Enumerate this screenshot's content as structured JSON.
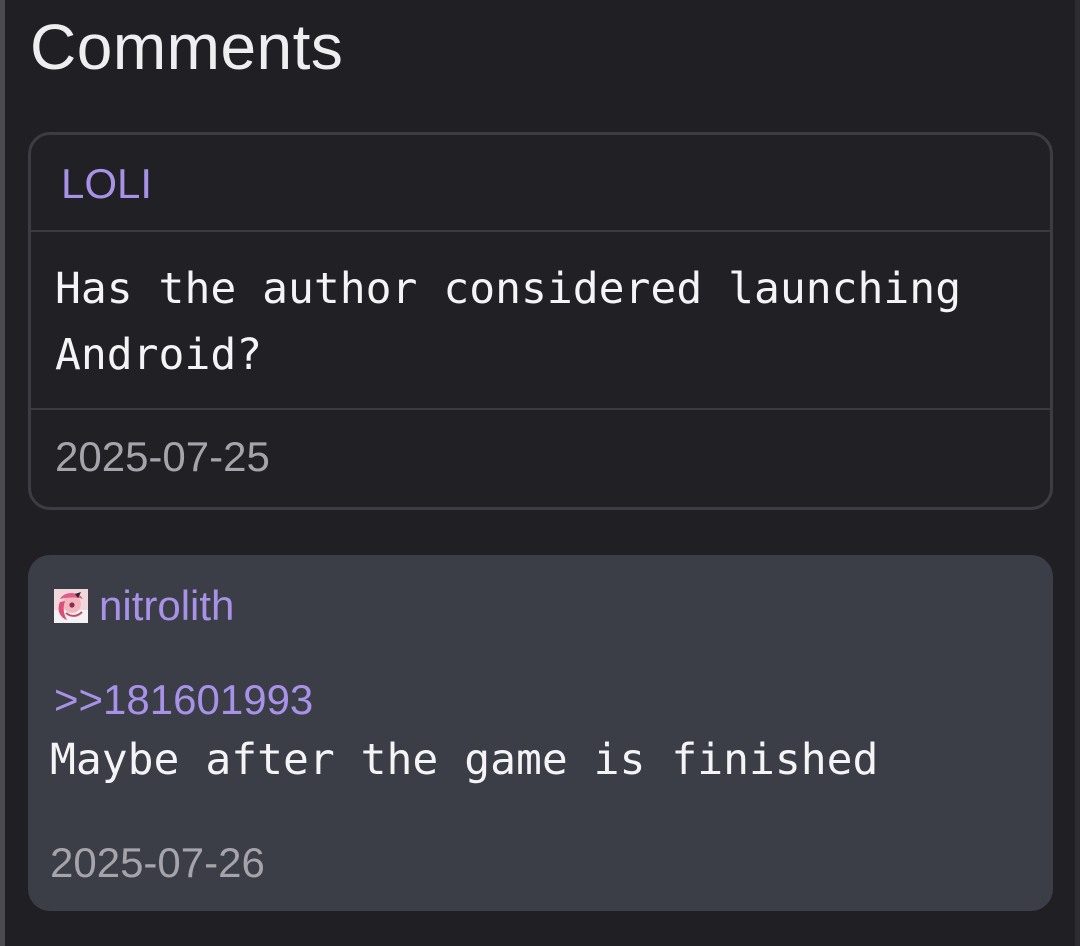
{
  "page": {
    "title": "Comments"
  },
  "comments": [
    {
      "author": "LOLI",
      "text": "Has the author considered launching Android?",
      "date": "2025-07-25"
    },
    {
      "author": "nitrolith",
      "avatar_icon": "user-avatar-icon",
      "reply_to": ">>181601993",
      "text": "Maybe after the game is finished",
      "date": "2025-07-26"
    }
  ],
  "colors": {
    "background": "#1f1f24",
    "accent": "#a892e8",
    "card_border": "#3c3c42",
    "highlight_card": "#3c3e47",
    "text": "#f4f4f6",
    "muted_text": "#a4a4aa"
  }
}
